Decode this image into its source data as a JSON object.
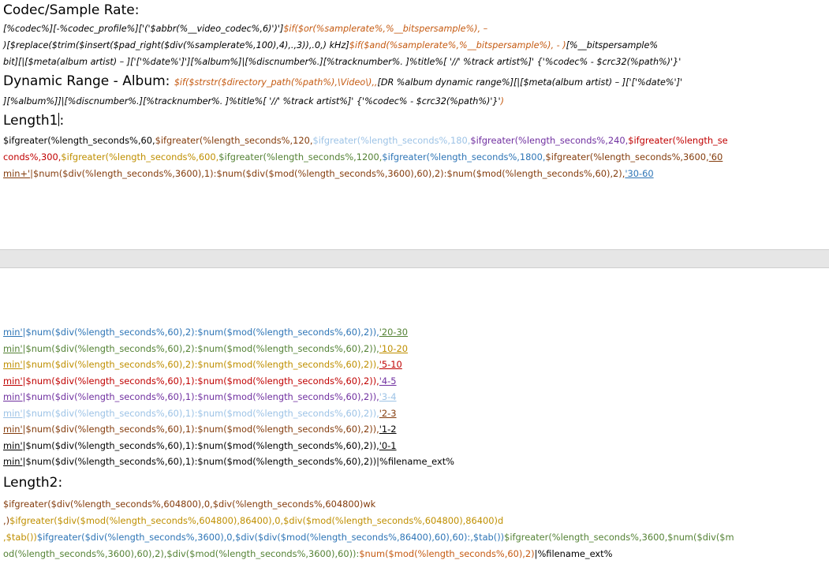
{
  "headings": {
    "codec": "Codec/Sample Rate:",
    "dynamic_prefix": "Dynamic Range - Album:",
    "length1": "Length1",
    "length1_colon": ":",
    "length2": "Length2:"
  },
  "codec_lines": [
    [
      {
        "t": "[%codec%][-%codec_profile%]['('$abbr(%__video_codec%,6)')']",
        "c": "k"
      },
      {
        "t": "$if($or(%samplerate%,%__bitspersample%), –",
        "c": "o"
      }
    ],
    [
      {
        "t": ")[$replace($trim($insert($pad_right($div(%samplerate%,100),4),.,3)),.0,) kHz]",
        "c": "k"
      },
      {
        "t": "$if($and(%samplerate%,%__bitspersample%), - )",
        "c": "o"
      },
      {
        "t": "[%__bitspersample%",
        "c": "k"
      }
    ],
    [
      {
        "t": "bit][|[$meta(album artist) – ]['['%date%']'][%album%]|[%discnumber%.][%tracknumber%. ]%title%[ '//' %track artist%]' {'%codec% - $crc32(%path%)'}'",
        "c": "k"
      }
    ]
  ],
  "dynamic_lines": [
    [
      {
        "t": "$if($strstr($directory_path(%path%),\\Video\\),,",
        "c": "o"
      },
      {
        "t": "[DR %album dynamic range%][|[$meta(album artist) – ]['['%date%']'",
        "c": "k"
      }
    ],
    [
      {
        "t": "][%album%]]|[%discnumber%.][%tracknumber%. ]%title%[ '//' %track artist%]' {'%codec% - $crc32(%path%)'}'",
        "c": "k"
      },
      {
        "t": ")",
        "c": "o"
      }
    ]
  ],
  "length1_lines": [
    [
      {
        "t": "$ifgreater(%length_seconds%,60,",
        "c": "k"
      },
      {
        "t": "$ifgreater(%length_seconds%,120,",
        "c": "br"
      },
      {
        "t": "$ifgreater(%length_seconds%,180,",
        "c": "lb"
      },
      {
        "t": "$ifgreater(%length_seconds%,240,",
        "c": "pu"
      },
      {
        "t": "$ifgreater(%length_se",
        "c": "re"
      }
    ],
    [
      {
        "t": "conds%,300,",
        "c": "re"
      },
      {
        "t": "$ifgreater(%length_seconds%,600,",
        "c": "go"
      },
      {
        "t": "$ifgreater(%length_seconds%,1200,",
        "c": "gr"
      },
      {
        "t": "$ifgreater(%length_seconds%,1800,",
        "c": "bl"
      },
      {
        "t": "$ifgreater(%length_seconds%,3600,",
        "c": "br"
      },
      {
        "t": "'60",
        "c": "br",
        "u": true
      }
    ],
    [
      {
        "t": "min+'",
        "c": "br",
        "u": true
      },
      {
        "t": "|$num($div(%length_seconds%,3600),1):$num($div($mod(%length_seconds%,3600),60),2):$num($mod(%length_seconds%,60),2),",
        "c": "br"
      },
      {
        "t": "'30-60",
        "c": "bl",
        "u": true
      }
    ]
  ],
  "page2_lines": [
    [
      {
        "t": "min'",
        "c": "bl",
        "u": true
      },
      {
        "t": "|$num($div(%length_seconds%,60),2):$num($mod(%length_seconds%,60),2)),",
        "c": "bl"
      },
      {
        "t": "'20-30",
        "c": "gr",
        "u": true
      }
    ],
    [
      {
        "t": "min'",
        "c": "gr",
        "u": true
      },
      {
        "t": "|$num($div(%length_seconds%,60),2):$num($mod(%length_seconds%,60),2)),",
        "c": "gr"
      },
      {
        "t": "'10-20",
        "c": "go",
        "u": true
      }
    ],
    [
      {
        "t": "min'",
        "c": "go",
        "u": true
      },
      {
        "t": "|$num($div(%length_seconds%,60),2):$num($mod(%length_seconds%,60),2)),",
        "c": "go"
      },
      {
        "t": "'5-10",
        "c": "re",
        "u": true
      }
    ],
    [
      {
        "t": "min'",
        "c": "re",
        "u": true
      },
      {
        "t": "|$num($div(%length_seconds%,60),1):$num($mod(%length_seconds%,60),2)),",
        "c": "re"
      },
      {
        "t": "'4-5",
        "c": "pu",
        "u": true
      }
    ],
    [
      {
        "t": "min'",
        "c": "pu",
        "u": true
      },
      {
        "t": "|$num($div(%length_seconds%,60),1):$num($mod(%length_seconds%,60),2)),",
        "c": "pu"
      },
      {
        "t": "'3-4",
        "c": "lb",
        "u": true
      }
    ],
    [
      {
        "t": "min'",
        "c": "lb",
        "u": true
      },
      {
        "t": "|$num($div(%length_seconds%,60),1):$num($mod(%length_seconds%,60),2)),",
        "c": "lb"
      },
      {
        "t": "'2-3",
        "c": "br",
        "u": true
      }
    ],
    [
      {
        "t": "min'",
        "c": "br",
        "u": true
      },
      {
        "t": "|$num($div(%length_seconds%,60),1):$num($mod(%length_seconds%,60),2)),",
        "c": "br"
      },
      {
        "t": "'1-2",
        "c": "k",
        "u": true
      }
    ],
    [
      {
        "t": "min'",
        "c": "k",
        "u": true
      },
      {
        "t": "|$num($div(%length_seconds%,60),1):$num($mod(%length_seconds%,60),2)),",
        "c": "k"
      },
      {
        "t": "'0-1",
        "c": "k",
        "u": true
      }
    ],
    [
      {
        "t": "min'",
        "c": "k",
        "u": true
      },
      {
        "t": "|$num($div(%length_seconds%,60),1):$num($mod(%length_seconds%,60),2))|%filename_ext%",
        "c": "k"
      }
    ]
  ],
  "length2_lines": [
    [
      {
        "t": "$ifgreater($div(%length_seconds%,604800),0,$div(%length_seconds%,604800)wk",
        "c": "br"
      }
    ],
    [
      {
        "t": ",)",
        "c": "br"
      },
      {
        "t": "$ifgreater($div($mod(%length_seconds%,604800),86400),0,$div($mod(%length_seconds%,604800),86400)d",
        "c": "go"
      }
    ],
    [
      {
        "t": ",$tab())",
        "c": "go"
      },
      {
        "t": "$ifgreater($div(%length_seconds%,3600),0,$div($div($mod(%length_seconds%,86400),60),60):,$tab())",
        "c": "bl"
      },
      {
        "t": "$ifgreater(%length_seconds%,3600,$num($div($m",
        "c": "gr"
      }
    ],
    [
      {
        "t": "od(%length_seconds%,3600),60),2),$div($mod(%length_seconds%,3600),60)):",
        "c": "gr"
      },
      {
        "t": "$num($mod(%length_seconds%,60),2)",
        "c": "o"
      },
      {
        "t": "|%filename_ext%",
        "c": "k"
      }
    ]
  ]
}
